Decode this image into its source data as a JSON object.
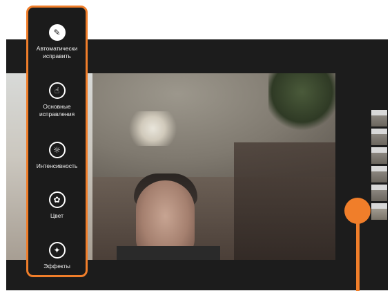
{
  "edit_panel": {
    "items": [
      {
        "label": "Автоматически исправить",
        "icon": "auto-fix-icon"
      },
      {
        "label": "Основные исправления",
        "icon": "touch-icon"
      },
      {
        "label": "Интенсивность",
        "icon": "brightness-icon"
      },
      {
        "label": "Цвет",
        "icon": "color-icon"
      },
      {
        "label": "Эффекты",
        "icon": "effects-icon"
      }
    ]
  },
  "filmstrip": {
    "count": 6,
    "selected_index": 5
  },
  "colors": {
    "accent": "#f07e2a",
    "panel_bg": "#1b1b1b",
    "app_bg": "#1c1c1c"
  }
}
